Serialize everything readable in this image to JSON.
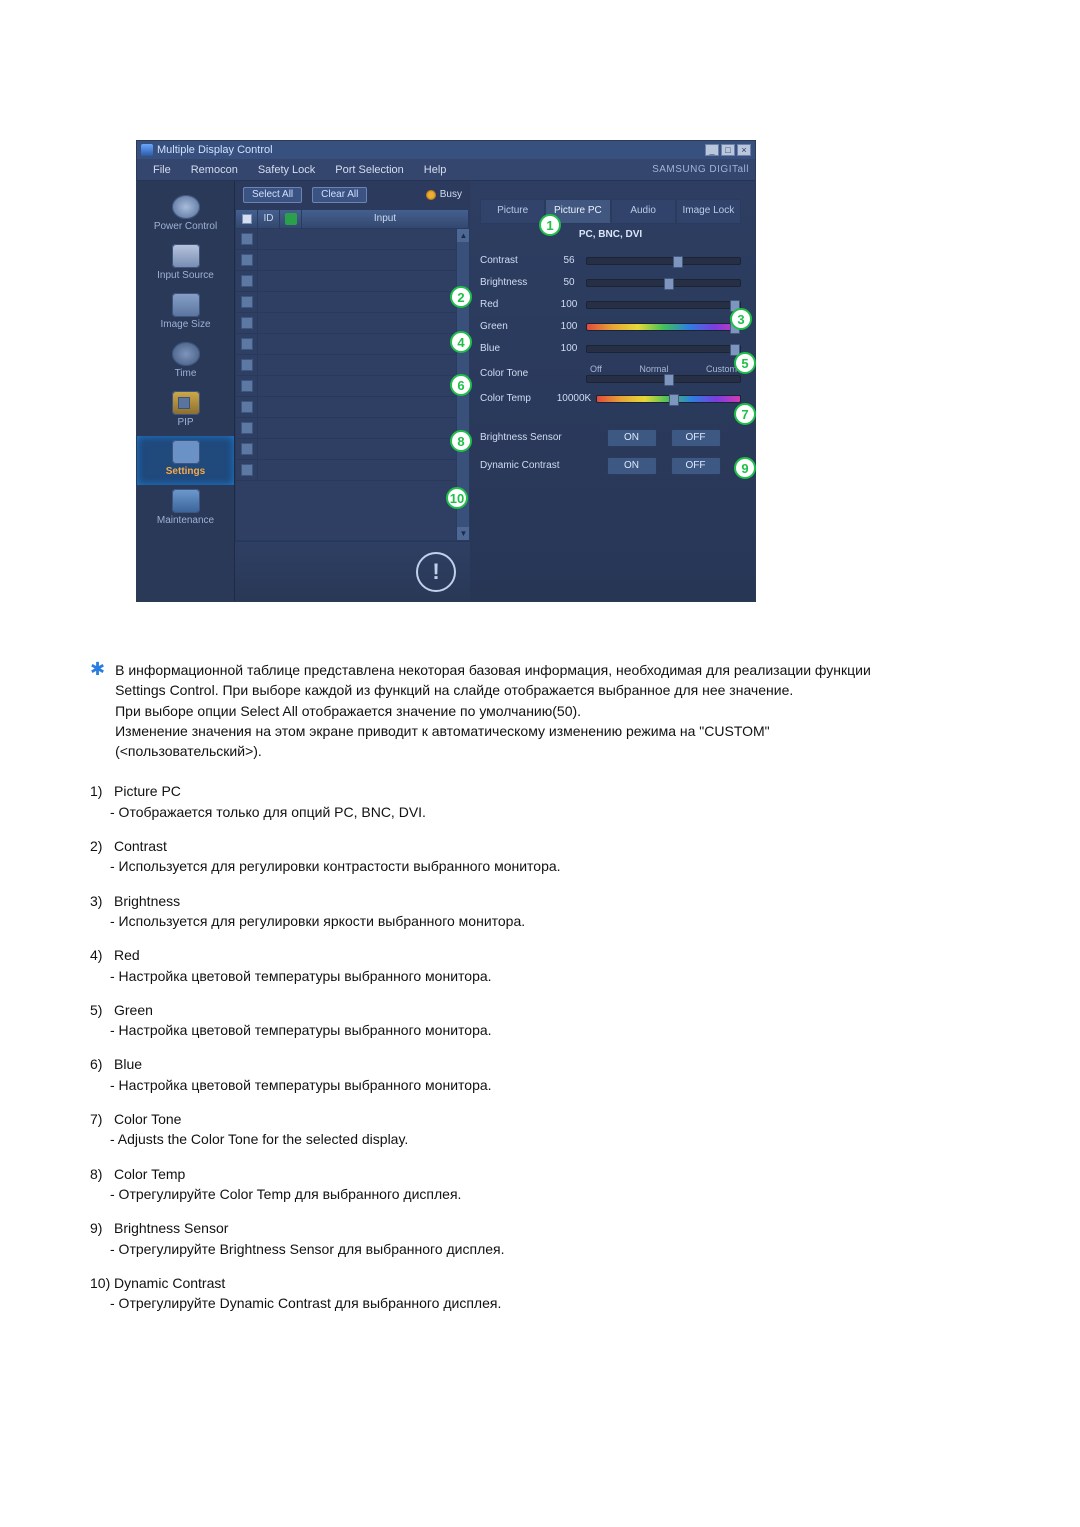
{
  "window": {
    "title": "Multiple Display Control",
    "menu": [
      "File",
      "Remocon",
      "Safety Lock",
      "Port Selection",
      "Help"
    ],
    "brand": "SAMSUNG DIGITall"
  },
  "left_nav": [
    {
      "label": "Power Control",
      "icon": "power"
    },
    {
      "label": "Input Source",
      "icon": "input"
    },
    {
      "label": "Image Size",
      "icon": "size"
    },
    {
      "label": "Time",
      "icon": "time"
    },
    {
      "label": "PIP",
      "icon": "pip"
    },
    {
      "label": "Settings",
      "icon": "settings",
      "selected": true
    },
    {
      "label": "Maintenance",
      "icon": "maintenance"
    }
  ],
  "center": {
    "select_all": "Select All",
    "clear_all": "Clear All",
    "busy": "Busy",
    "columns": {
      "id": "ID",
      "input": "Input"
    }
  },
  "tabs": [
    "Picture",
    "Picture PC",
    "Audio",
    "Image Lock"
  ],
  "active_tab": 1,
  "tabs_sub": "PC, BNC, DVI",
  "sliders": {
    "contrast": {
      "label": "Contrast",
      "value": 56,
      "max": 100
    },
    "brightness": {
      "label": "Brightness",
      "value": 50,
      "max": 100
    },
    "red": {
      "label": "Red",
      "value": 100,
      "max": 100
    },
    "green": {
      "label": "Green",
      "value": 100,
      "max": 100
    },
    "blue": {
      "label": "Blue",
      "value": 100,
      "max": 100
    }
  },
  "color_tone": {
    "label": "Color Tone",
    "options": [
      "Off",
      "Normal",
      "Custom"
    ],
    "value": "Normal"
  },
  "color_temp": {
    "label": "Color Temp",
    "value": "10000K"
  },
  "brightness_sensor": {
    "label": "Brightness Sensor",
    "on": "ON",
    "off": "OFF"
  },
  "dynamic_contrast": {
    "label": "Dynamic Contrast",
    "on": "ON",
    "off": "OFF"
  },
  "callouts": [
    "1",
    "2",
    "3",
    "4",
    "5",
    "6",
    "7",
    "8",
    "9",
    "10"
  ],
  "doc": {
    "star_para": [
      "В информационной таблице представлена некоторая базовая информация, необходимая для реализации функции Settings Control. При выборе каждой из функций на слайде отображается выбранное для нее значение.",
      "При выборе опции Select All отображается значение по умолчанию(50).",
      "Изменение значения на этом экране приводит к автоматическому изменению режима на \"CUSTOM\" (<пользовательский>)."
    ],
    "items": [
      {
        "n": "1)",
        "t": "Picture PC",
        "d": "- Отображается только для опций PC, BNC, DVI."
      },
      {
        "n": "2)",
        "t": "Contrast",
        "d": "- Используется для регулировки контрастости выбранного монитора."
      },
      {
        "n": "3)",
        "t": "Brightness",
        "d": "- Используется для регулировки яркости выбранного монитора."
      },
      {
        "n": "4)",
        "t": "Red",
        "d": "- Настройка цветовой температуры выбранного монитора."
      },
      {
        "n": "5)",
        "t": "Green",
        "d": "- Настройка цветовой температуры выбранного монитора."
      },
      {
        "n": "6)",
        "t": "Blue",
        "d": "- Настройка цветовой температуры выбранного монитора."
      },
      {
        "n": "7)",
        "t": "Color Tone",
        "d": "- Adjusts the Color Tone for the selected display."
      },
      {
        "n": "8)",
        "t": "Color Temp",
        "d": "- Отрегулируйте Color Temp для выбранного дисплея."
      },
      {
        "n": "9)",
        "t": "Brightness Sensor",
        "d": "- Отрегулируйте Brightness Sensor для выбранного дисплея."
      },
      {
        "n": "10)",
        "t": "Dynamic Contrast",
        "d": "- Отрегулируйте Dynamic Contrast для выбранного дисплея."
      }
    ]
  }
}
